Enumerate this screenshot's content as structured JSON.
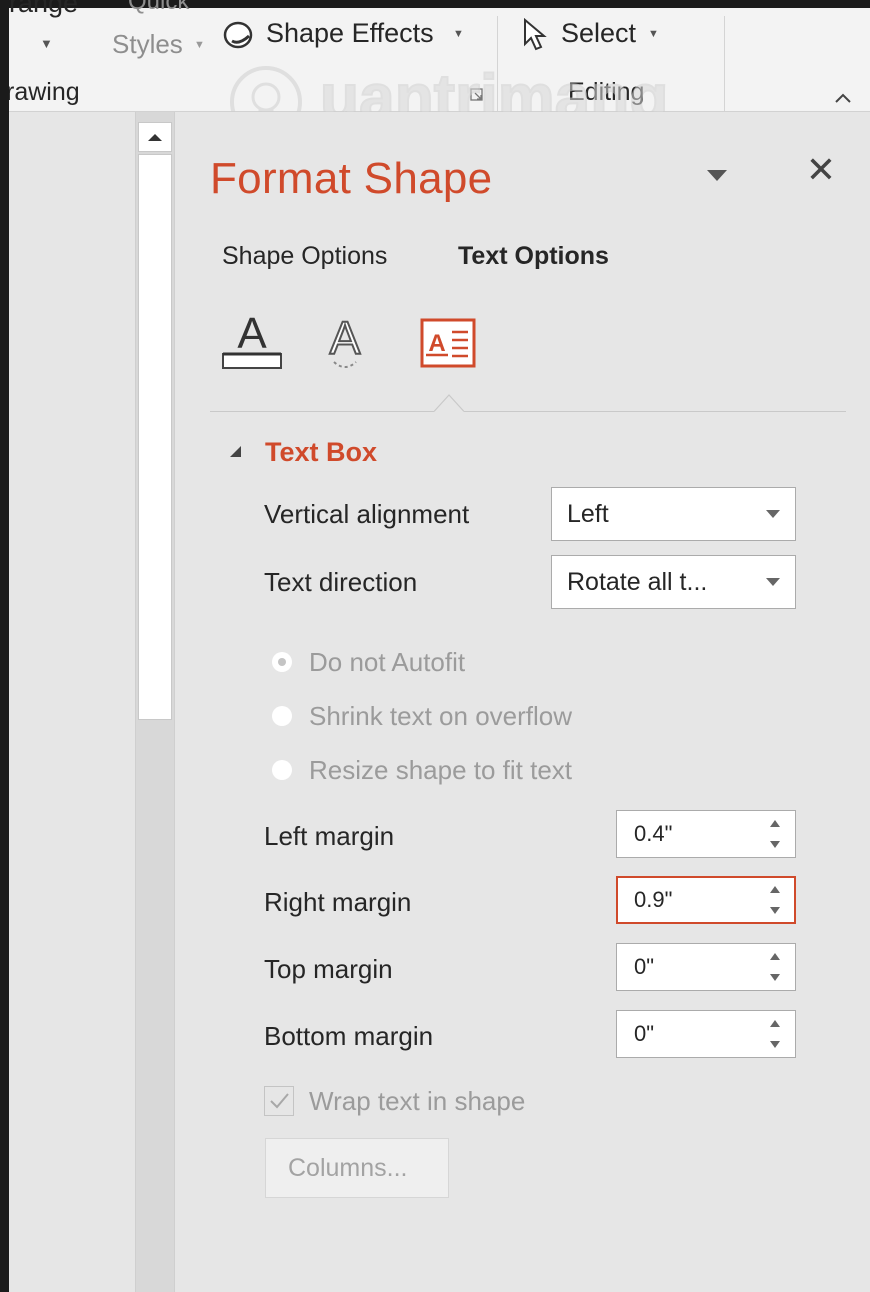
{
  "ribbon": {
    "arrange_partial": "rrange",
    "quick_partial": "Quick",
    "styles_label": "Styles",
    "shape_effects_label": "Shape Effects",
    "select_label": "Select",
    "drawing_group": "rawing",
    "editing_group": "Editing"
  },
  "watermark": {
    "text": "uantrimang"
  },
  "pane": {
    "title": "Format Shape",
    "tabs": [
      {
        "label": "Shape Options"
      },
      {
        "label": "Text Options"
      }
    ],
    "icon_tabs": [
      {
        "icon": "text-fill-outline-icon"
      },
      {
        "icon": "text-effects-icon"
      },
      {
        "icon": "text-box-icon",
        "selected": true
      }
    ],
    "accent_color": "#d04a2b"
  },
  "text_box": {
    "section_title": "Text Box",
    "vertical_alignment": {
      "label": "Vertical alignment",
      "value": "Left"
    },
    "text_direction": {
      "label": "Text direction",
      "value": "Rotate all t..."
    },
    "autofit": [
      {
        "label": "Do not Autofit",
        "selected": true
      },
      {
        "label": "Shrink text on overflow",
        "selected": false
      },
      {
        "label": "Resize shape to fit text",
        "selected": false
      }
    ],
    "margins": {
      "left": {
        "label": "Left margin",
        "value": "0.4\""
      },
      "right": {
        "label": "Right margin",
        "value": "0.9\""
      },
      "top": {
        "label": "Top margin",
        "value": "0\""
      },
      "bottom": {
        "label": "Bottom margin",
        "value": "0\""
      }
    },
    "wrap_text": {
      "label": "Wrap text in shape",
      "checked": true
    },
    "columns_button": "Columns..."
  }
}
